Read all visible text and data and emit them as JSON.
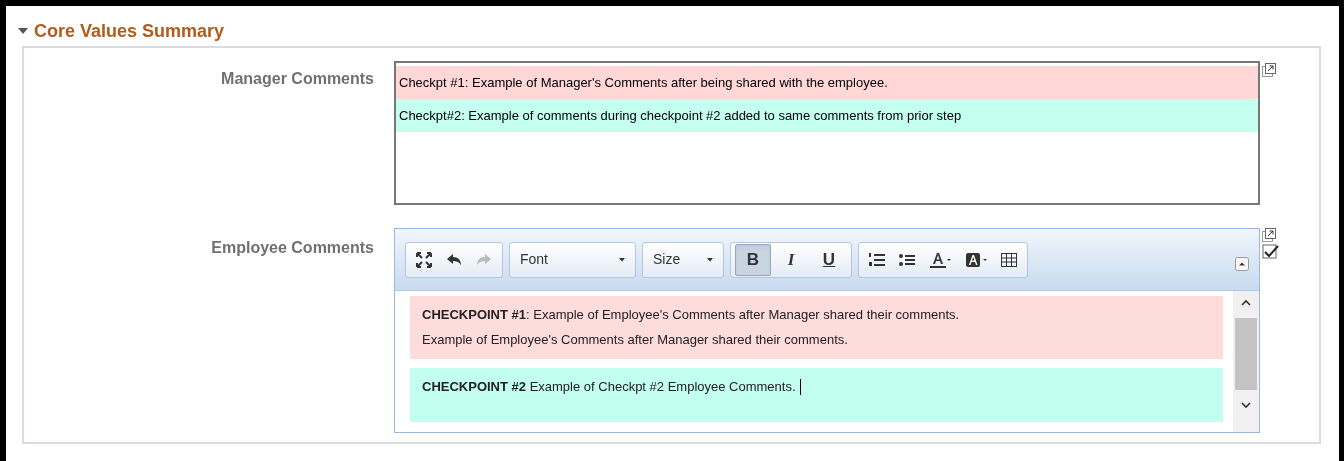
{
  "section": {
    "title": "Core Values Summary",
    "expanded": true
  },
  "manager_comments": {
    "label": "Manager Comments",
    "paragraphs": [
      {
        "text": "Checkpt #1: Example of Manager's Comments after being shared with the employee.",
        "color": "#ffd7d7"
      },
      {
        "text": "Checkpt#2: Example of comments during checkpoint #2 added to same comments from prior step",
        "color": "#c4fff0"
      }
    ]
  },
  "employee_comments": {
    "label": "Employee Comments",
    "toolbar": {
      "font": "Font",
      "size": "Size",
      "format_buttons": [
        {
          "label": "B",
          "pressed": true
        },
        {
          "label": "I",
          "pressed": false
        },
        {
          "label": "U",
          "pressed": false
        }
      ]
    },
    "blocks": [
      {
        "color": "#ffdcdc",
        "lines": [
          "**CHECKPOINT #1**: Example of Employee's Comments after Manager shared their comments.",
          "Example of Employee's Comments after Manager shared their comments."
        ]
      },
      {
        "color": "#c2fff0",
        "lines": [
          "**CHECKPOINT #2** Example of Checkpt #2 Employee Comments."
        ],
        "caret": true
      }
    ]
  }
}
